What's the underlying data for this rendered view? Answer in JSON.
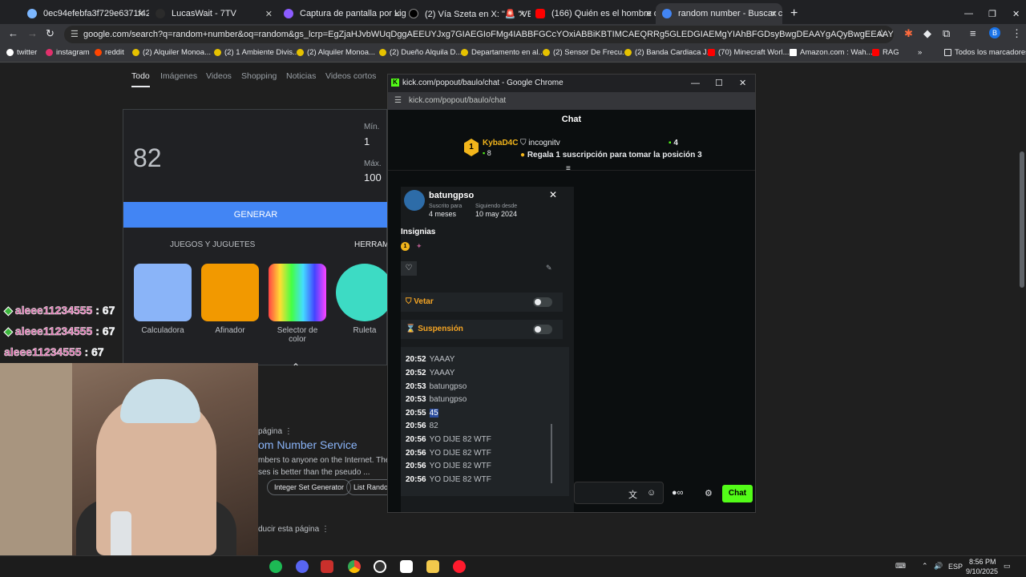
{
  "browser": {
    "tabs": [
      {
        "label": "0ec94efebfa3f729e6371f42a0b",
        "fav": "#7cb7ff"
      },
      {
        "label": "LucasWait - 7TV",
        "fav": "#2b2b2b"
      },
      {
        "label": "Captura de pantalla por Lightsh",
        "fav": "#8c5cff"
      },
      {
        "label": "(2) Vía Szeta en X: \"🚨 \"VENGO",
        "fav": "#000000"
      },
      {
        "label": "(166) Quién es el hombre que",
        "fav": "#ff0000"
      },
      {
        "label": "random number - Buscar con G",
        "fav": "#4285f4"
      }
    ],
    "url": "google.com/search?q=random+number&oq=random&gs_lcrp=EgZjaHJvbWUqDggAEEUYJxg7GIAEGIoFMg4IABBFGCcYOxiABBiKBTIMCAEQRRg5GLEDGIAEMgYIAhBFGDsyBwgDEAAYgAQyBwgEEAAYgAQyBwgFEAAYgAQyBggGEEUYPTIGC...",
    "bookmarks": [
      "twitter",
      "instagram",
      "reddit",
      "(2) Alquiler Monoa...",
      "(2) 1 Ambiente Divis...",
      "(2) Alquiler Monoa...",
      "(2) Dueño Alquila D...",
      "Departamento en al...",
      "(2) Sensor De Frecu...",
      "(2) Banda Cardiaca J...",
      "(70) Minecraft Worl...",
      "Amazon.com : Wah...",
      "RAG"
    ],
    "all_bookmarks": "Todos los marcadores"
  },
  "google": {
    "tabs": [
      "Todo",
      "Imágenes",
      "Videos",
      "Shopping",
      "Noticias",
      "Videos cortos"
    ],
    "rng": {
      "result": "82",
      "min_label": "Mín.",
      "min_value": "1",
      "max_label": "Máx.",
      "max_value": "100",
      "generate": "GENERAR"
    },
    "tools_tabs": [
      "JUEGOS Y JUGUETES",
      "HERRAM"
    ],
    "tools": [
      "Calculadora",
      "Afinador",
      "Selector de color",
      "Ruleta"
    ],
    "result_source": "página",
    "result_title": "om Number Service",
    "result_snippet_1": "mbers to anyone on the Internet. The ra",
    "result_snippet_2": "ses is better than the pseudo ...",
    "pills": [
      "Integer Set Generator",
      "List Random"
    ],
    "translate": "ducir esta página"
  },
  "overlay": {
    "lines": [
      {
        "name": "aleee11234555",
        "count": "67"
      },
      {
        "name": "aleee11234555",
        "count": "67"
      },
      {
        "name": "aleee11234555",
        "count": "67"
      }
    ]
  },
  "popup": {
    "window_title": "kick.com/popout/baulo/chat - Google Chrome",
    "url": "kick.com/popout/baulo/chat",
    "chat_title": "Chat",
    "leaderboard": {
      "rank": "1",
      "top_user": "KybaD4C",
      "top_count": "8",
      "second_user": "incognitv",
      "second_count": "4",
      "gift_prompt": "Regala 1 suscripción para tomar la posición 3"
    },
    "user_card": {
      "username": "batungpso",
      "sub_label": "Suscrito para",
      "sub_value": "4 meses",
      "follow_label": "Siguiendo desde",
      "follow_value": "10 may 2024",
      "badges_title": "Insignias",
      "badge_rank": "1",
      "veto_label": "Vetar",
      "suspension_label": "Suspensión"
    },
    "messages": [
      {
        "time": "20:52",
        "text": "YAAAY"
      },
      {
        "time": "20:52",
        "text": "YAAAY"
      },
      {
        "time": "20:53",
        "text": "batungpso"
      },
      {
        "time": "20:53",
        "text": "batungpso"
      },
      {
        "time": "20:55",
        "text": "45"
      },
      {
        "time": "20:56",
        "text": "82"
      },
      {
        "time": "20:56",
        "text": "YO DIJE 82 WTF"
      },
      {
        "time": "20:56",
        "text": "YO DIJE 82 WTF"
      },
      {
        "time": "20:56",
        "text": "YO DIJE 82 WTF"
      },
      {
        "time": "20:56",
        "text": "YO DIJE 82 WTF"
      }
    ],
    "chat_button": "Chat"
  },
  "taskbar": {
    "lang": "ESP",
    "time": "8:56 PM",
    "date": "9/10/2025"
  },
  "colors": {
    "kick_green": "#53fc18",
    "google_blue": "#4285f4",
    "rank_gold": "#f2b51b",
    "veto_orange": "#f5a524"
  }
}
